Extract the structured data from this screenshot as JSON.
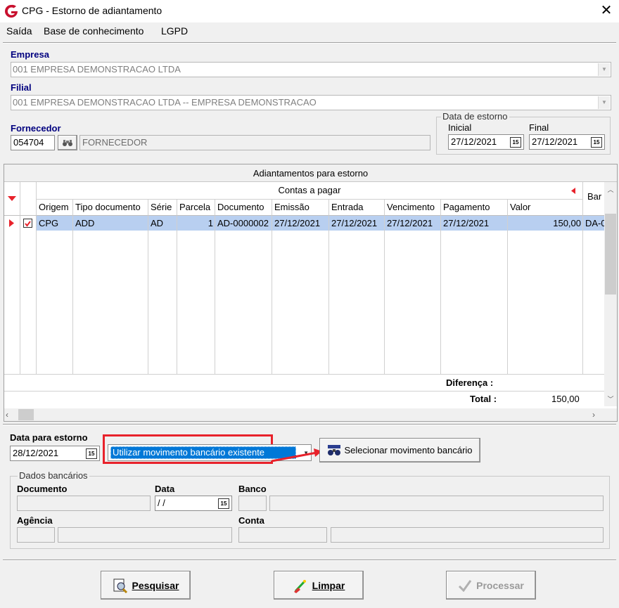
{
  "window": {
    "title": "CPG - Estorno de adiantamento",
    "close": "✕"
  },
  "menu": {
    "items": [
      "Saída",
      "Base de conhecimento",
      "LGPD"
    ]
  },
  "empresa": {
    "label": "Empresa",
    "value": "001 EMPRESA DEMONSTRACAO LTDA"
  },
  "filial": {
    "label": "Filial",
    "value": "001 EMPRESA DEMONSTRACAO LTDA -- EMPRESA DEMONSTRACAO"
  },
  "fornecedor": {
    "label": "Fornecedor",
    "code": "054704",
    "name": "FORNECEDOR"
  },
  "estorno_range": {
    "title": "Data de estorno",
    "inicial_label": "Inicial",
    "inicial": "27/12/2021",
    "final_label": "Final",
    "final": "27/12/2021"
  },
  "grid": {
    "title": "Adiantamentos para estorno",
    "group_header": "Contas a pagar",
    "extra_header": "Bar",
    "columns": [
      "Origem",
      "Tipo documento",
      "Série",
      "Parcela",
      "Documento",
      "Emissão",
      "Entrada",
      "Vencimento",
      "Pagamento",
      "Valor"
    ],
    "rows": [
      {
        "checked": true,
        "cells": [
          "CPG",
          "ADD",
          "AD",
          "1",
          "AD-0000002",
          "27/12/2021",
          "27/12/2021",
          "27/12/2021",
          "27/12/2021",
          "150,00"
        ],
        "extra": "DA-0"
      }
    ],
    "footer": {
      "diferenca_label": "Diferença :",
      "diferenca": "",
      "total_label": "Total :",
      "total": "150,00"
    }
  },
  "data_estorno": {
    "label": "Data para estorno",
    "value": "28/12/2021"
  },
  "movimento": {
    "selected": "Utilizar movimento bancário existente",
    "button": "Selecionar movimento bancário"
  },
  "dados_bancarios": {
    "title": "Dados bancários",
    "documento_label": "Documento",
    "data_label": "Data",
    "data_value": " / /",
    "banco_label": "Banco",
    "agencia_label": "Agência",
    "conta_label": "Conta"
  },
  "buttons": {
    "pesquisar": "Pesquisar",
    "limpar": "Limpar",
    "processar": "Processar"
  },
  "colors": {
    "accent": "#00007f",
    "highlight": "#e8222b",
    "selection": "#b8cff0",
    "combo_selected": "#0078d7"
  }
}
